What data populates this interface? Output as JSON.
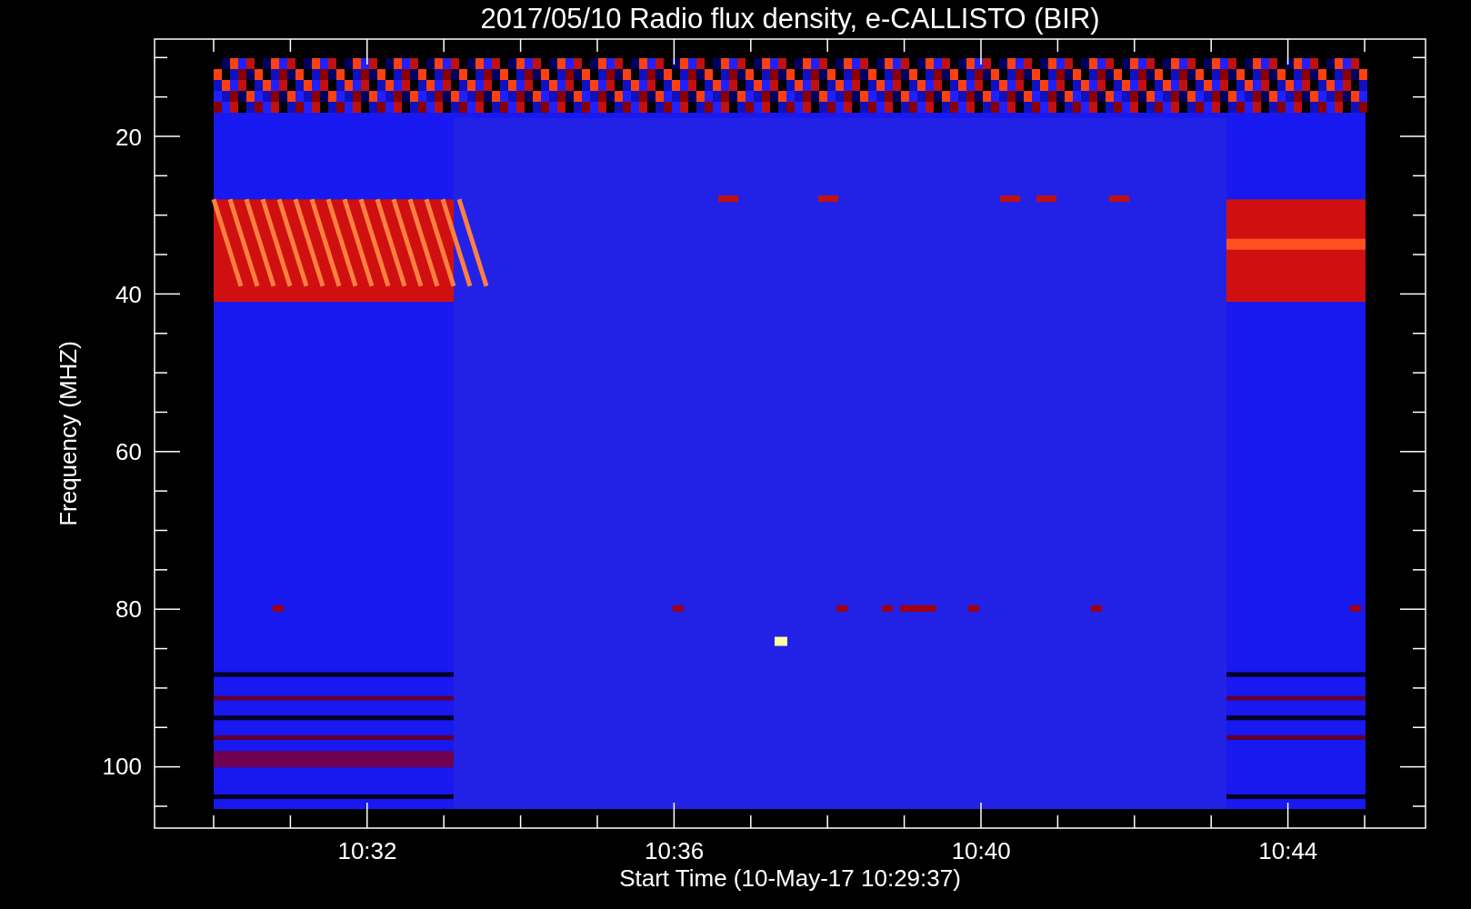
{
  "title": "2017/05/10  Radio flux density, e-CALLISTO (BIR)",
  "y_axis": {
    "label": "Frequency (MHZ)",
    "ticks": [
      "20",
      "40",
      "60",
      "80",
      "100"
    ]
  },
  "x_axis": {
    "label": "Start Time (10-May-17 10:29:37)",
    "ticks": [
      "10:32",
      "10:36",
      "10:40",
      "10:44"
    ]
  }
}
